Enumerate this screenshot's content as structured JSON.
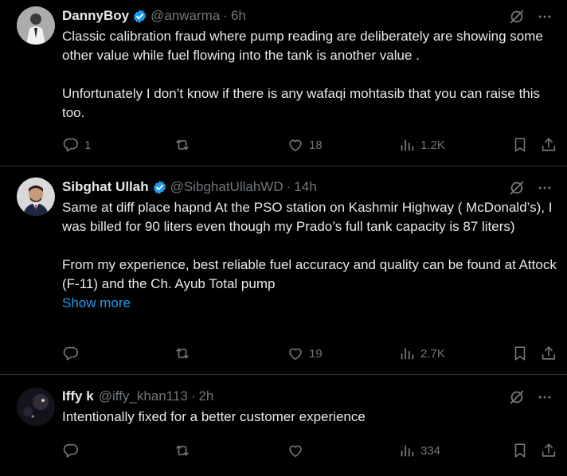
{
  "colors": {
    "background": "#000000",
    "text": "#e7e9ea",
    "muted": "#71767b",
    "accent": "#1d9bf0",
    "border": "#2f3336"
  },
  "tweets": [
    {
      "name": "DannyBoy",
      "verified": true,
      "handle": "@anwarma",
      "dot": "·",
      "time": "6h",
      "paragraphs": [
        "Classic calibration fraud where pump reading are deliberately are showing some other value while fuel flowing into the tank is another value .",
        "Unfortunately I don’t know if there is any wafaqi mohtasib that you can raise this too."
      ],
      "show_more": "",
      "replies": "1",
      "retweets": "",
      "likes": "18",
      "views": "1.2K"
    },
    {
      "name": "Sibghat Ullah",
      "verified": true,
      "handle": "@SibghatUllahWD",
      "dot": "·",
      "time": "14h",
      "paragraphs": [
        "Same at diff place hapnd At the PSO station on Kashmir Highway ( McDonald’s), I was billed for 90 liters even though my Prado’s full tank capacity is 87 liters)",
        "From my experience, best reliable fuel accuracy and quality can be found at Attock (F-11) and the Ch. Ayub Total pump"
      ],
      "show_more": "Show more",
      "replies": "",
      "retweets": "",
      "likes": "19",
      "views": "2.7K"
    },
    {
      "name": "Iffy k",
      "verified": false,
      "handle": "@iffy_khan113",
      "dot": "·",
      "time": "2h",
      "paragraphs": [
        "Intentionally fixed for a better customer experience"
      ],
      "show_more": "",
      "replies": "",
      "retweets": "",
      "likes": "",
      "views": "334"
    }
  ],
  "icons": {
    "reply": "reply-icon",
    "retweet": "retweet-icon",
    "like": "heart-icon",
    "views": "views-icon",
    "bookmark": "bookmark-icon",
    "share": "share-icon",
    "grok": "grok-icon",
    "more": "more-icon",
    "verified": "verified-badge-icon"
  }
}
